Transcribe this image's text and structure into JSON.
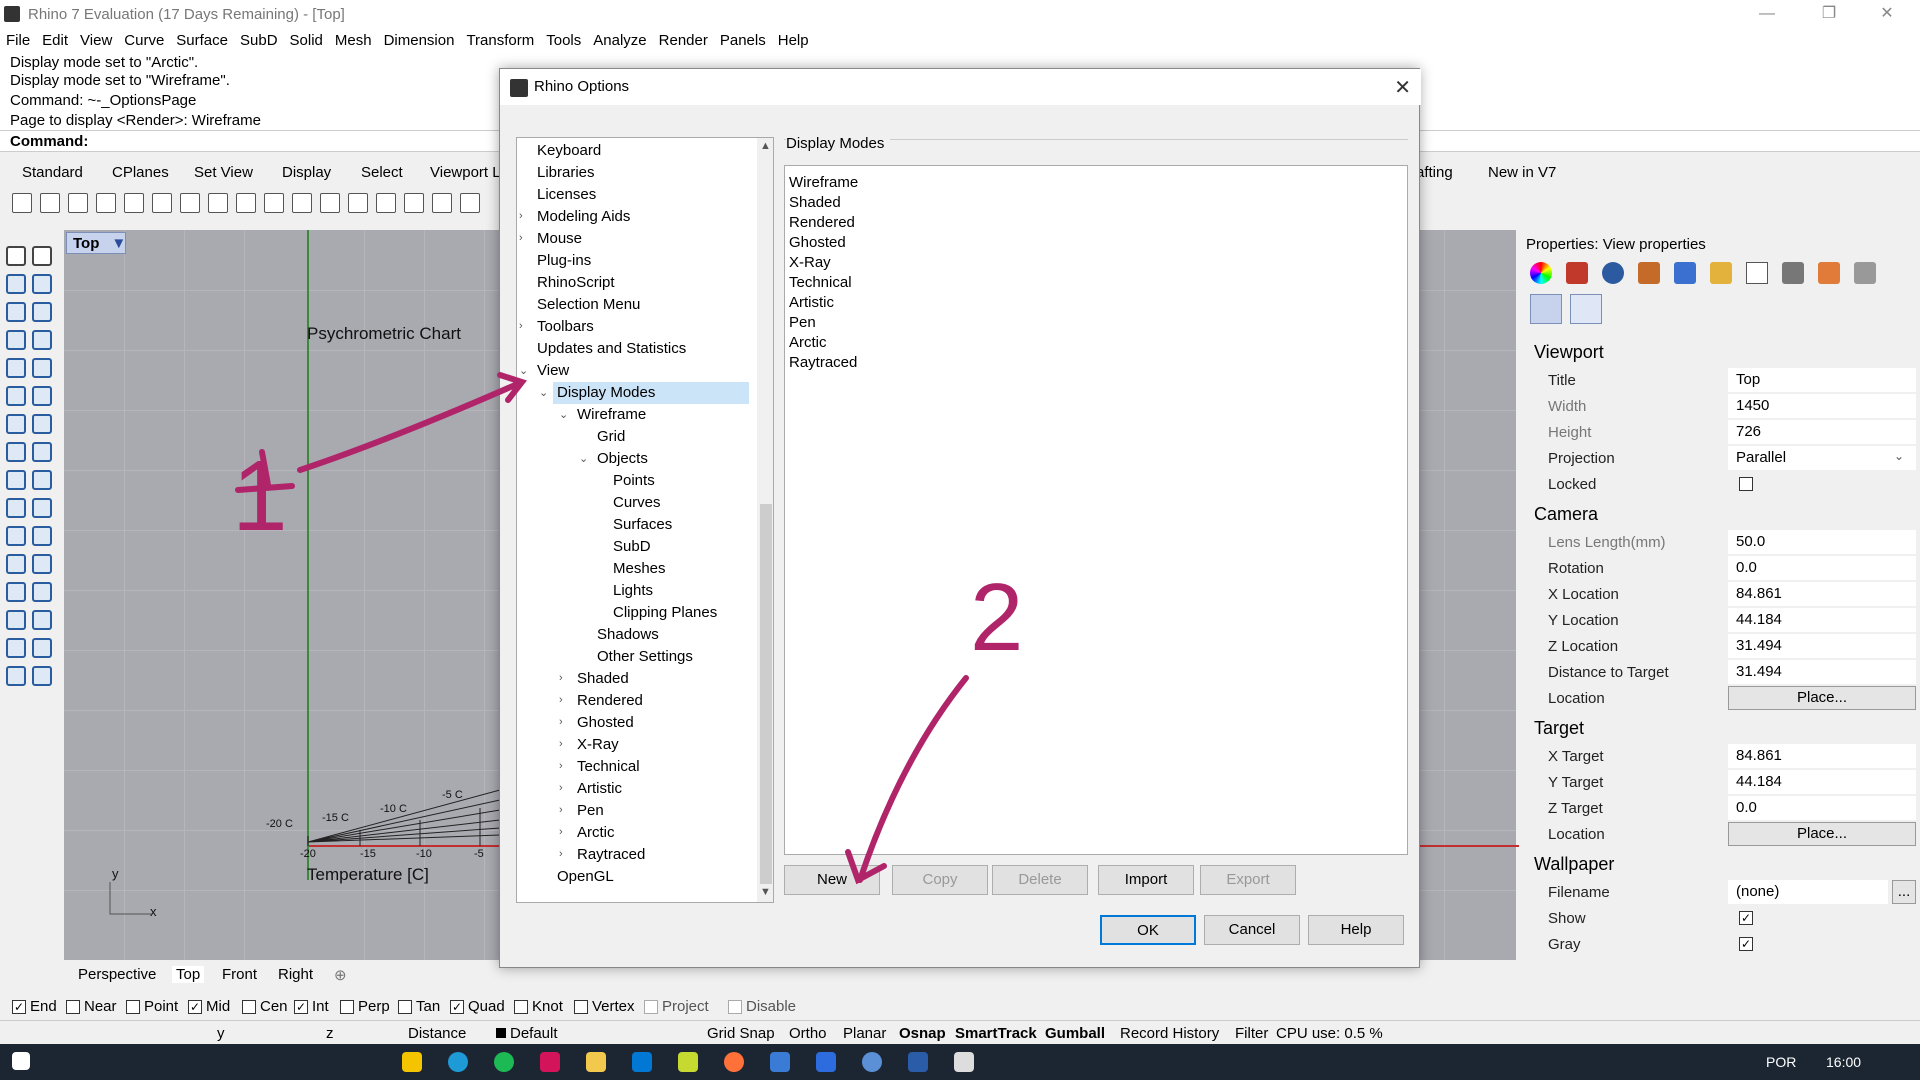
{
  "window": {
    "title": "Rhino 7 Evaluation (17 Days Remaining) - [Top]",
    "min": "—",
    "restore": "❐",
    "close": "✕"
  },
  "menu": [
    "File",
    "Edit",
    "View",
    "Curve",
    "Surface",
    "SubD",
    "Solid",
    "Mesh",
    "Dimension",
    "Transform",
    "Tools",
    "Analyze",
    "Render",
    "Panels",
    "Help"
  ],
  "command_history": [
    "Display mode set to \"Arctic\".",
    "Display mode set to \"Wireframe\".",
    "Command: ~-_OptionsPage",
    "Page to display <Render>: Wireframe"
  ],
  "command_prompt": "Command:",
  "toolbar_tabs": [
    "Standard",
    "CPlanes",
    "Set View",
    "Display",
    "Select",
    "Viewport L",
    "afting",
    "New in V7"
  ],
  "viewport": {
    "name": "Top",
    "chart_title": "Psychrometric Chart",
    "x_axis_label": "Temperature [C]",
    "temps": [
      "-20 C",
      "-15 C",
      "-10 C",
      "-5 C"
    ],
    "ticks": [
      "-20",
      "-15",
      "-10",
      "-5"
    ],
    "axis_y": "y",
    "axis_x": "x"
  },
  "view_tabs": [
    "Perspective",
    "Top",
    "Front",
    "Right"
  ],
  "view_tab_add": "⊕",
  "osnaps": [
    {
      "label": "End",
      "checked": true
    },
    {
      "label": "Near",
      "checked": false
    },
    {
      "label": "Point",
      "checked": false
    },
    {
      "label": "Mid",
      "checked": true
    },
    {
      "label": "Cen",
      "checked": false
    },
    {
      "label": "Int",
      "checked": true
    },
    {
      "label": "Perp",
      "checked": false
    },
    {
      "label": "Tan",
      "checked": false
    },
    {
      "label": "Quad",
      "checked": true
    },
    {
      "label": "Knot",
      "checked": false
    },
    {
      "label": "Vertex",
      "checked": false
    },
    {
      "label": "Project",
      "checked": false
    },
    {
      "label": "Disable",
      "checked": false
    }
  ],
  "status": {
    "y": "y",
    "z": "z",
    "distance": "Distance",
    "layer": "Default",
    "items": [
      "Grid Snap",
      "Ortho",
      "Planar",
      "Osnap",
      "SmartTrack",
      "Gumball",
      "Record History",
      "Filter",
      "CPU use: 0.5 %"
    ]
  },
  "taskbar": {
    "lang": "POR",
    "time": "16:00"
  },
  "dialog": {
    "title": "Rhino Options",
    "close": "✕",
    "tree": [
      {
        "label": "Keyboard",
        "indent": 0,
        "arrow": ""
      },
      {
        "label": "Libraries",
        "indent": 0,
        "arrow": ""
      },
      {
        "label": "Licenses",
        "indent": 0,
        "arrow": ""
      },
      {
        "label": "Modeling Aids",
        "indent": 0,
        "arrow": "›"
      },
      {
        "label": "Mouse",
        "indent": 0,
        "arrow": "›"
      },
      {
        "label": "Plug-ins",
        "indent": 0,
        "arrow": ""
      },
      {
        "label": "RhinoScript",
        "indent": 0,
        "arrow": ""
      },
      {
        "label": "Selection Menu",
        "indent": 0,
        "arrow": ""
      },
      {
        "label": "Toolbars",
        "indent": 0,
        "arrow": "›"
      },
      {
        "label": "Updates and Statistics",
        "indent": 0,
        "arrow": ""
      },
      {
        "label": "View",
        "indent": 0,
        "arrow": "⌄"
      },
      {
        "label": "Display Modes",
        "indent": 1,
        "arrow": "⌄",
        "selected": true
      },
      {
        "label": "Wireframe",
        "indent": 2,
        "arrow": "⌄"
      },
      {
        "label": "Grid",
        "indent": 3,
        "arrow": ""
      },
      {
        "label": "Objects",
        "indent": 3,
        "arrow": "⌄"
      },
      {
        "label": "Points",
        "indent": 4,
        "arrow": ""
      },
      {
        "label": "Curves",
        "indent": 4,
        "arrow": ""
      },
      {
        "label": "Surfaces",
        "indent": 4,
        "arrow": ""
      },
      {
        "label": "SubD",
        "indent": 4,
        "arrow": ""
      },
      {
        "label": "Meshes",
        "indent": 4,
        "arrow": ""
      },
      {
        "label": "Lights",
        "indent": 4,
        "arrow": ""
      },
      {
        "label": "Clipping Planes",
        "indent": 4,
        "arrow": ""
      },
      {
        "label": "Shadows",
        "indent": 3,
        "arrow": ""
      },
      {
        "label": "Other Settings",
        "indent": 3,
        "arrow": ""
      },
      {
        "label": "Shaded",
        "indent": 2,
        "arrow": "›"
      },
      {
        "label": "Rendered",
        "indent": 2,
        "arrow": "›"
      },
      {
        "label": "Ghosted",
        "indent": 2,
        "arrow": "›"
      },
      {
        "label": "X-Ray",
        "indent": 2,
        "arrow": "›"
      },
      {
        "label": "Technical",
        "indent": 2,
        "arrow": "›"
      },
      {
        "label": "Artistic",
        "indent": 2,
        "arrow": "›"
      },
      {
        "label": "Pen",
        "indent": 2,
        "arrow": "›"
      },
      {
        "label": "Arctic",
        "indent": 2,
        "arrow": "›"
      },
      {
        "label": "Raytraced",
        "indent": 2,
        "arrow": "›"
      },
      {
        "label": "OpenGL",
        "indent": 1,
        "arrow": ""
      }
    ],
    "group_title": "Display Modes",
    "modes": [
      "Wireframe",
      "Shaded",
      "Rendered",
      "Ghosted",
      "X-Ray",
      "Technical",
      "Artistic",
      "Pen",
      "Arctic",
      "Raytraced"
    ],
    "buttons": {
      "new": "New",
      "copy": "Copy",
      "delete": "Delete",
      "import": "Import",
      "export": "Export"
    },
    "footer": {
      "ok": "OK",
      "cancel": "Cancel",
      "help": "Help"
    }
  },
  "properties": {
    "header": "Properties: View properties",
    "viewport_section": "Viewport",
    "viewport_rows": [
      {
        "label": "Title",
        "value": "Top"
      },
      {
        "label": "Width",
        "value": "1450"
      },
      {
        "label": "Height",
        "value": "726"
      },
      {
        "label": "Projection",
        "value": "Parallel"
      }
    ],
    "locked_label": "Locked",
    "camera_section": "Camera",
    "camera_rows": [
      {
        "label": "Lens Length(mm)",
        "value": "50.0"
      },
      {
        "label": "Rotation",
        "value": "0.0"
      },
      {
        "label": "X Location",
        "value": "84.861"
      },
      {
        "label": "Y Location",
        "value": "44.184"
      },
      {
        "label": "Z Location",
        "value": "31.494"
      },
      {
        "label": "Distance to Target",
        "value": "31.494"
      }
    ],
    "location_label": "Location",
    "place_label": "Place...",
    "target_section": "Target",
    "target_rows": [
      {
        "label": "X Target",
        "value": "84.861"
      },
      {
        "label": "Y Target",
        "value": "44.184"
      },
      {
        "label": "Z Target",
        "value": "0.0"
      }
    ],
    "wallpaper_section": "Wallpaper",
    "filename_label": "Filename",
    "filename_value": "(none)",
    "browse": "...",
    "show_label": "Show",
    "gray_label": "Gray"
  },
  "annotations": {
    "one": "1",
    "two": "2",
    "color": "#b0246a"
  }
}
